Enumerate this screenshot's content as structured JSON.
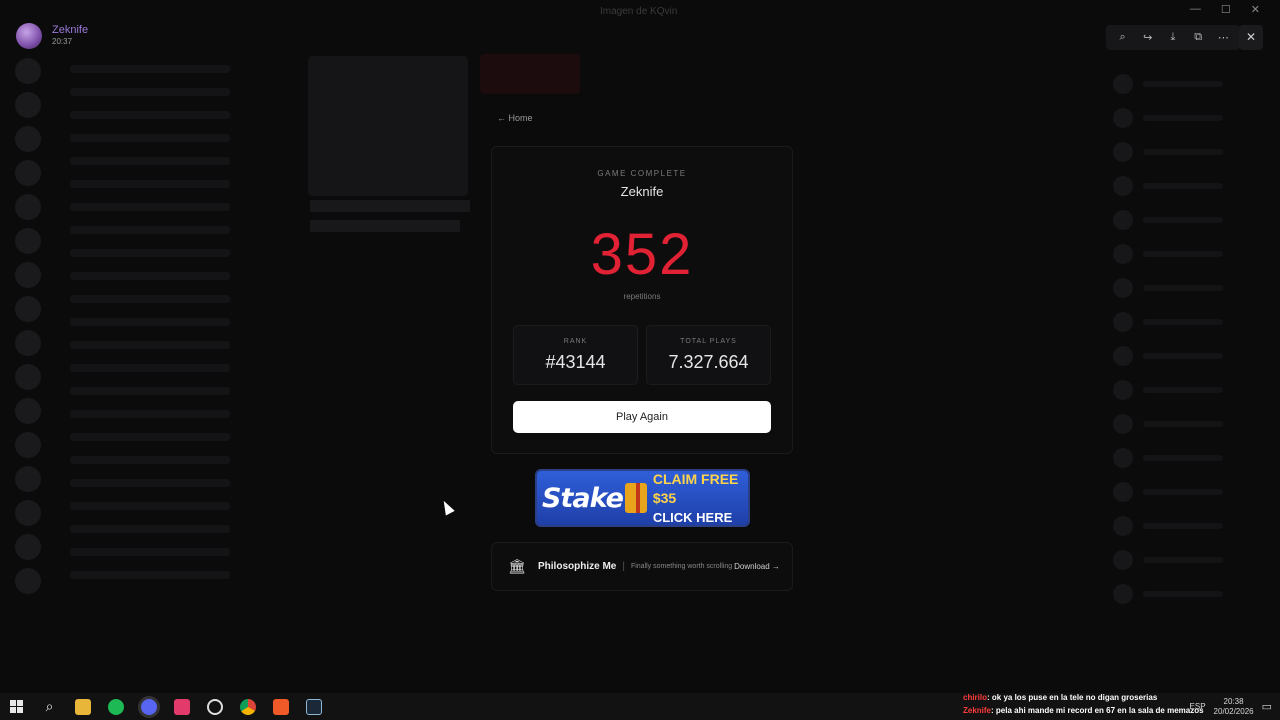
{
  "user": {
    "name": "Zeknife",
    "time": "20:37"
  },
  "window": {
    "title": "Imagen de KQvin"
  },
  "window_controls": {
    "minimize": "—",
    "maximize": "☐",
    "close": "✕"
  },
  "viewer_toolbar": {
    "zoom_icon": "zoom-in-icon",
    "forward_icon": "forward-icon",
    "download_icon": "download-icon",
    "open_icon": "open-external-icon",
    "more_icon": "more-icon",
    "close_icon": "close-icon"
  },
  "game": {
    "home_link": "← Home",
    "status": "GAME COMPLETE",
    "player": "Zeknife",
    "score": "352",
    "score_label": "repetitions",
    "rank_label": "RANK",
    "rank_value": "#43144",
    "plays_label": "TOTAL PLAYS",
    "plays_value": "7.327.664",
    "play_again": "Play Again",
    "accent_color": "#e02234"
  },
  "promo": {
    "brand": "Stake",
    "claim": "CLAIM FREE $35",
    "cta": "CLICK HERE"
  },
  "sponsor": {
    "name": "Philosophize Me",
    "tagline": "Finally something worth scrolling",
    "cta": "Download →"
  },
  "stream_chat": [
    {
      "user": "chirilo",
      "text": ": ok ya los puse en la tele no digan groserias"
    },
    {
      "user": "Zeknife",
      "text": ": pela ahi mande mi record en 67 en la sala de memazos"
    }
  ],
  "tray": {
    "lang": "ESP",
    "time": "20:38",
    "date": "20/02/2026"
  }
}
